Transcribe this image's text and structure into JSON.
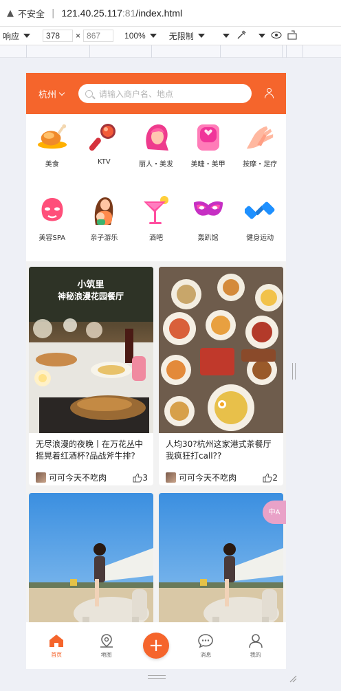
{
  "browser": {
    "security_label": "不安全",
    "url_host": "121.40.25.117",
    "url_port": ":81",
    "url_path": "/index.html"
  },
  "devtools": {
    "device_mode": "响应",
    "width": "378",
    "times": "×",
    "height": "867",
    "zoom": "100%",
    "throttle": "无限制"
  },
  "header": {
    "city": "杭州",
    "search_placeholder": "请输入商户名、地点"
  },
  "categories": [
    {
      "label": "美食",
      "icon": "roast-chicken-icon"
    },
    {
      "label": "KTV",
      "icon": "microphone-icon"
    },
    {
      "label": "丽人・美发",
      "icon": "hair-salon-icon"
    },
    {
      "label": "美睫・美甲",
      "icon": "nail-polish-icon"
    },
    {
      "label": "按摩・足疗",
      "icon": "massage-hands-icon"
    },
    {
      "label": "美容SPA",
      "icon": "face-mask-icon"
    },
    {
      "label": "亲子游乐",
      "icon": "parent-child-icon"
    },
    {
      "label": "酒吧",
      "icon": "cocktail-icon"
    },
    {
      "label": "轰趴馆",
      "icon": "party-mask-icon"
    },
    {
      "label": "健身运动",
      "icon": "dumbbell-icon"
    }
  ],
  "feed": [
    {
      "title": "无尽浪漫的夜晚丨在万花丛中摇晃着红酒杯?品战斧牛排?",
      "author": "可可今天不吃肉",
      "likes": "3",
      "photo_caption": "小筑里\n神秘浪漫花园餐厅"
    },
    {
      "title": "人均30?杭州这家港式茶餐厅我疯狂打call??",
      "author": "可可今天不吃肉",
      "likes": "2"
    },
    {
      "title": "",
      "author": "",
      "likes": ""
    },
    {
      "title": "",
      "author": "",
      "likes": ""
    }
  ],
  "translate_fab": "中A",
  "tabs": [
    {
      "label": "首页",
      "icon": "home-icon",
      "active": true
    },
    {
      "label": "地图",
      "icon": "map-pin-icon",
      "active": false
    },
    {
      "label": "",
      "icon": "plus-icon",
      "active": false
    },
    {
      "label": "消息",
      "icon": "chat-bubble-icon",
      "active": false
    },
    {
      "label": "我的",
      "icon": "profile-icon",
      "active": false
    }
  ],
  "colors": {
    "brand": "#f5652c",
    "page_bg": "#f2f2f2"
  }
}
